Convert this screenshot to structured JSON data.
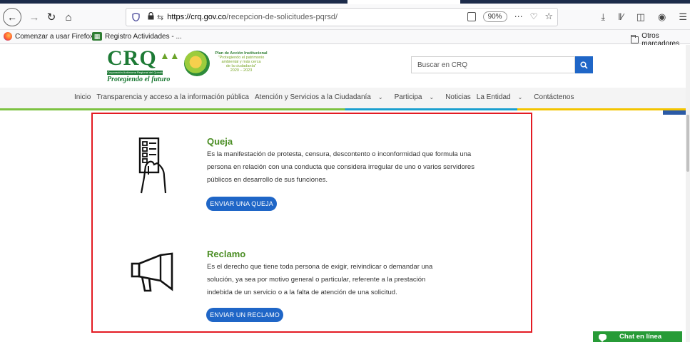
{
  "browser": {
    "url_host": "https://crq.gov.co",
    "url_path": "/recepcion-de-solicitudes-pqrsd/",
    "zoom": "90%",
    "bookmarks": [
      "Comenzar a usar Firefox",
      "Registro Actividades - ..."
    ],
    "other_bookmarks": "Otros marcadores"
  },
  "header": {
    "logo_text": "CRQ",
    "logo_bar": "Corporación Autónoma Regional del Quindío",
    "logo_slogan": "Protegiendo el futuro",
    "plan_title": "Plan de Acción Institucional",
    "plan_line1": "\"Protegiendo el patrimonio",
    "plan_line2": "ambiental y más cerca",
    "plan_line3": "de la ciudadanía\"",
    "plan_years": "2020 – 2023",
    "search_placeholder": "Buscar en CRQ"
  },
  "menu": {
    "items": [
      "Inicio",
      "Transparencia y acceso a la información pública",
      "Atención y Servicios a la Ciudadanía",
      "Participa",
      "Noticias",
      "La Entidad",
      "Contáctenos"
    ]
  },
  "cards": [
    {
      "title": "Queja",
      "lines": [
        "Es la manifestación de protesta, censura, descontento o inconformidad que formula una",
        "persona en relación con una conducta que considera irregular de uno o varios servidores",
        "públicos en desarrollo de sus funciones."
      ],
      "button": "ENVIAR UNA QUEJA"
    },
    {
      "title": "Reclamo",
      "lines": [
        "Es el derecho que tiene toda persona de exigir, reivindicar o demandar una",
        "solución, ya sea por motivo general o particular, referente a la prestación",
        "indebida de un servicio o a la falta de atención de una solicitud."
      ],
      "button": "ENVIAR UN RECLAMO"
    }
  ],
  "chat": {
    "label": "Chat en línea"
  },
  "colors": {
    "accent_blue": "#1f66c7",
    "title_green": "#4a8d23",
    "highlight_red": "#e31b23",
    "chat_green": "#279b37"
  }
}
